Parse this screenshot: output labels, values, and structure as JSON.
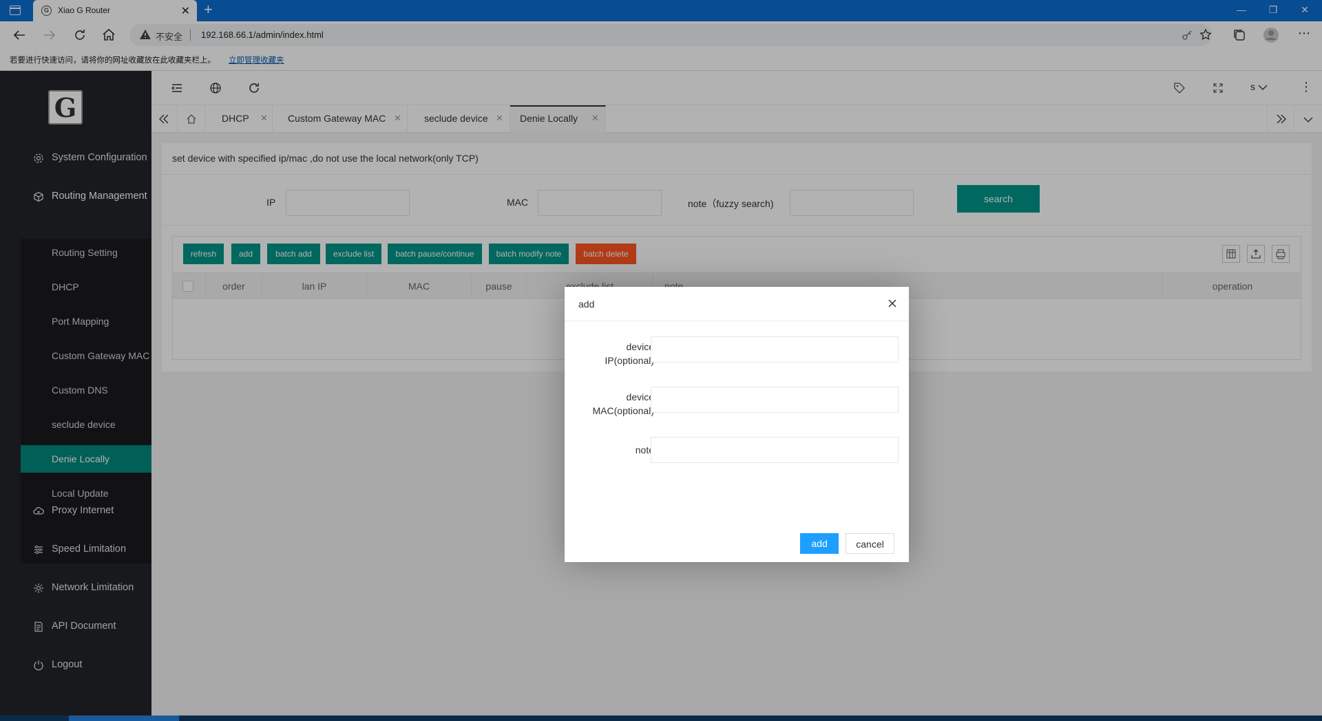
{
  "browser": {
    "tab_title": "Xiao G Router",
    "tab_favicon_letter": "G",
    "security_label": "不安全",
    "url": "192.168.66.1/admin/index.html",
    "favbar_tip": "若要进行快速访问，请将你的网址收藏放在此收藏夹栏上。",
    "favbar_link": "立即管理收藏夹"
  },
  "sidebar": {
    "logo_letter": "G",
    "top_items": [
      {
        "label": "System Configuration",
        "icon": "gear-icon"
      },
      {
        "label": "Routing Management",
        "icon": "cube-icon"
      },
      {
        "label": "Proxy Internet",
        "icon": "cloud-icon"
      },
      {
        "label": "Speed Limitation",
        "icon": "sliders-icon"
      },
      {
        "label": "Network Limitation",
        "icon": "network-icon"
      },
      {
        "label": "API Document",
        "icon": "document-icon"
      },
      {
        "label": "Logout",
        "icon": "power-icon"
      }
    ],
    "sub_items": [
      {
        "label": "Routing Setting"
      },
      {
        "label": "DHCP"
      },
      {
        "label": "Port Mapping"
      },
      {
        "label": "Custom Gateway MAC"
      },
      {
        "label": "Custom DNS"
      },
      {
        "label": "seclude device"
      },
      {
        "label": "Denie Locally"
      },
      {
        "label": "Local Update"
      }
    ],
    "active_sub": "Denie Locally"
  },
  "header": {
    "user_label": "s"
  },
  "page_tabs": [
    {
      "label": "DHCP"
    },
    {
      "label": "Custom Gateway MAC"
    },
    {
      "label": "seclude device"
    },
    {
      "label": "Denie Locally"
    }
  ],
  "main": {
    "description": "set device with specified ip/mac ,do not use the local network(only TCP)",
    "search_form": {
      "ip_label": "IP",
      "mac_label": "MAC",
      "note_label": "note（fuzzy search)",
      "search_button": "search"
    },
    "toolbar": {
      "refresh": "refresh",
      "add": "add",
      "batch_add": "batch add",
      "exclude_list": "exclude list",
      "batch_pause": "batch pause/continue",
      "batch_modify_note": "batch modify note",
      "batch_delete": "batch delete"
    },
    "table": {
      "columns": [
        "order",
        "lan IP",
        "MAC",
        "pause",
        "exclude list",
        "note",
        "operation"
      ]
    }
  },
  "modal": {
    "title": "add",
    "fields": [
      {
        "label_line1": "device",
        "label_line2": "IP(optional)"
      },
      {
        "label_line1": "device",
        "label_line2": "MAC(optional)"
      },
      {
        "label_line1": "note",
        "label_line2": ""
      }
    ],
    "confirm": "add",
    "cancel": "cancel"
  },
  "colors": {
    "accent": "#009688",
    "danger": "#ff5722",
    "primary": "#1e9fff",
    "sidebar_bg": "#222429",
    "browser_blue": "#0c6dd1"
  }
}
